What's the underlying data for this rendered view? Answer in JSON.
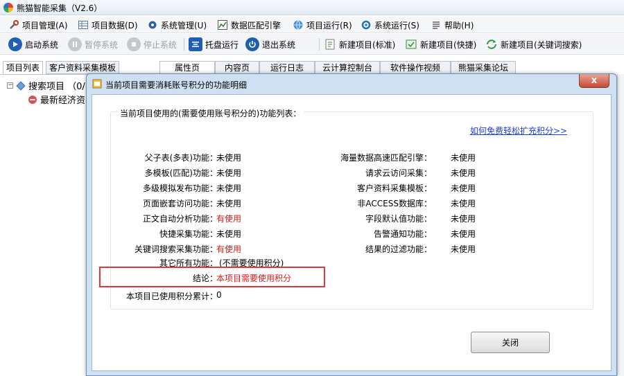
{
  "app": {
    "title": "熊猫智能采集（V2.6）"
  },
  "menu": [
    {
      "label": "项目管理(A)",
      "icon": "wrench-icon"
    },
    {
      "label": "项目数据(D)",
      "icon": "table-icon"
    },
    {
      "label": "系统管理(U)",
      "icon": "gear-icon"
    },
    {
      "label": "数据匹配引擎",
      "icon": "chart-icon"
    },
    {
      "label": "项目运行(R)",
      "icon": "globe-icon"
    },
    {
      "label": "系统运行(S)",
      "icon": "cog-run-icon"
    },
    {
      "label": "帮助(H)",
      "icon": "help-doc-icon"
    }
  ],
  "toolbar": {
    "start": "启动系统",
    "pause": "暂停系统",
    "stop": "停止系统",
    "tray": "托盘运行",
    "exit": "退出系统",
    "new_standard": "新建项目(标准)",
    "new_quick": "新建项目(快捷)",
    "new_keyword": "新建项目(关键词搜索)"
  },
  "left_tabs": [
    "项目列表",
    "客户资料采集模板"
  ],
  "tree": {
    "root": "搜索项目 （0/",
    "child": "最新经济资"
  },
  "right_tabs": [
    "属性页",
    "内容页",
    "运行日志",
    "云计算控制台",
    "软件操作视频",
    "熊猫采集论坛"
  ],
  "dialog": {
    "title": "当前项目需要消耗账号积分的功能明细",
    "close_x": "x",
    "group_title": "当前项目使用的(需要使用账号积分的)功能列表：",
    "help_link": "如何免费轻松扩充积分>>",
    "left_features": [
      {
        "label": "父子表(多表)功能：",
        "value": "未使用",
        "used": false
      },
      {
        "label": "多模板(匹配)功能：",
        "value": "未使用",
        "used": false
      },
      {
        "label": "多级模拟发布功能：",
        "value": "未使用",
        "used": false
      },
      {
        "label": "页面嵌套访问功能：",
        "value": "未使用",
        "used": false
      },
      {
        "label": "正文自动分析功能：",
        "value": "有使用",
        "used": true
      },
      {
        "label": "快捷采集功能：",
        "value": "未使用",
        "used": false
      },
      {
        "label": "关键词搜索采集功能：",
        "value": "有使用",
        "used": true
      }
    ],
    "right_features": [
      {
        "label": "海量数据高速匹配引擎：",
        "value": "未使用",
        "used": false
      },
      {
        "label": "请求云访问采集：",
        "value": "未使用",
        "used": false
      },
      {
        "label": "客户资料采集模板：",
        "value": "未使用",
        "used": false
      },
      {
        "label": "非ACCESS数据库：",
        "value": "未使用",
        "used": false
      },
      {
        "label": "字段默认值功能：",
        "value": "未使用",
        "used": false
      },
      {
        "label": "告警通知功能：",
        "value": "未使用",
        "used": false
      },
      {
        "label": "结果的过滤功能：",
        "value": "未使用",
        "used": false
      }
    ],
    "other_label": "其它所有功能：",
    "other_value": "(不需要使用积分)",
    "conclusion_label": "结论：",
    "conclusion_value": "本项目需要使用积分",
    "total_label": "本项目已使用积分累计：",
    "total_value": "0",
    "close_button": "关闭"
  },
  "colors": {
    "used": "#d61b1b",
    "link": "#1a3fd6",
    "highlight": "#e53535"
  }
}
